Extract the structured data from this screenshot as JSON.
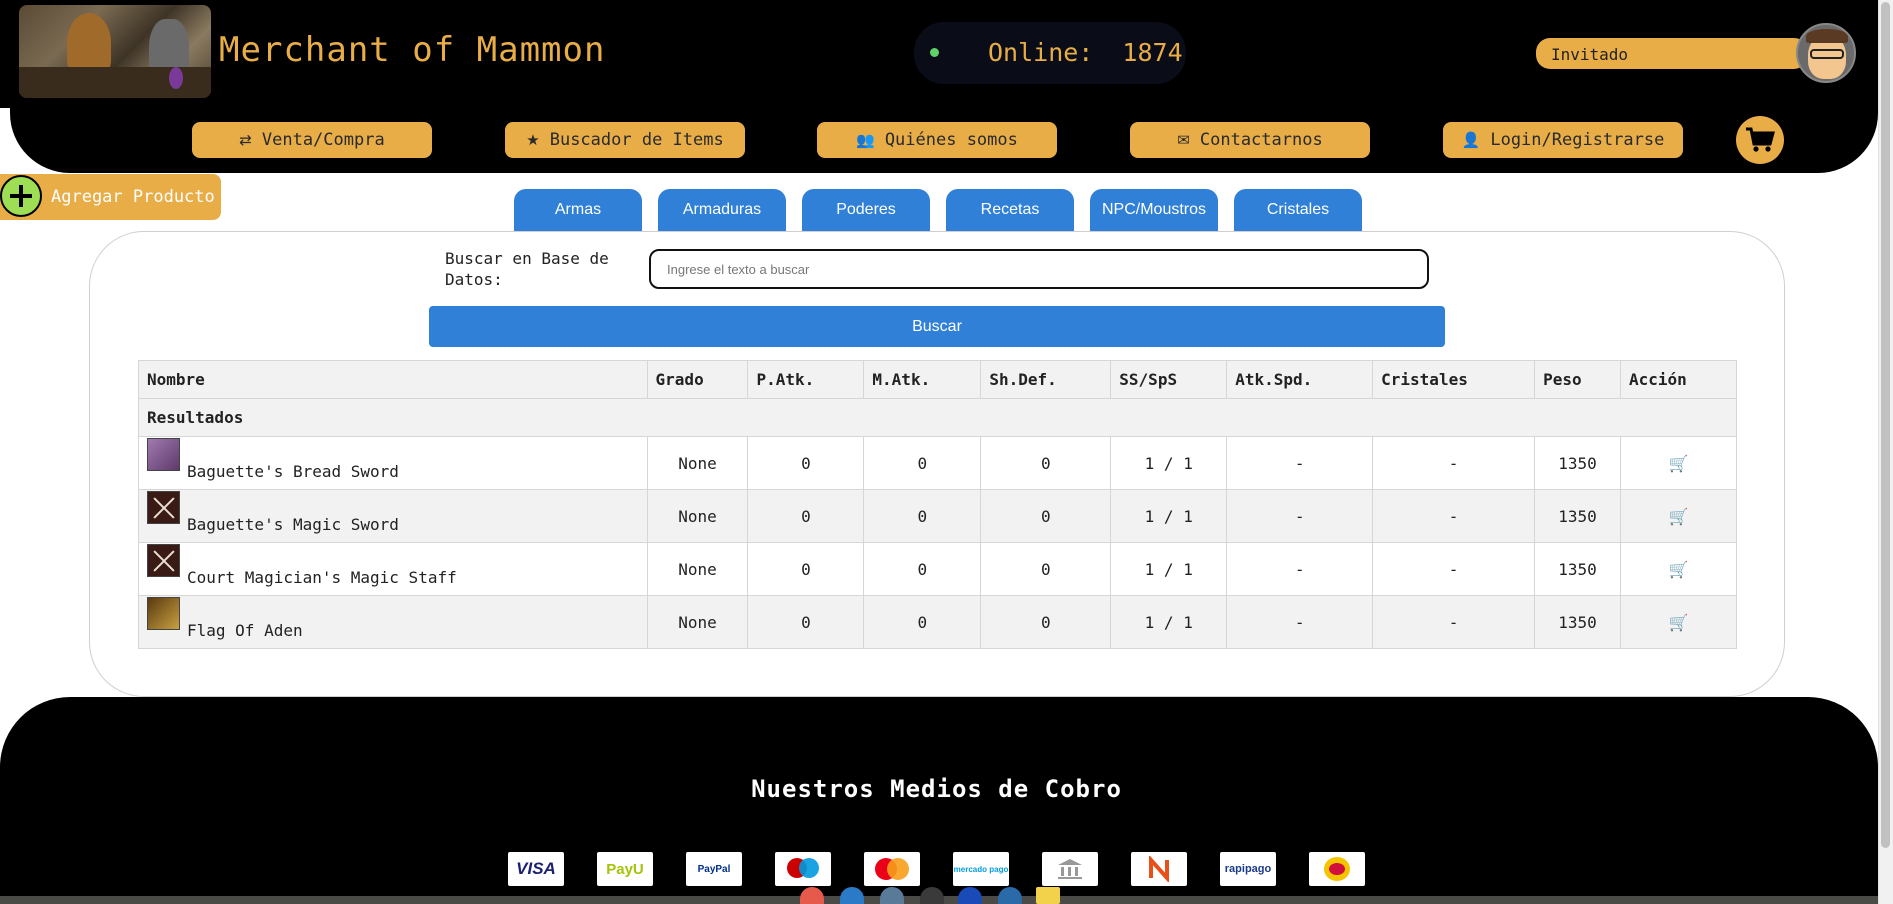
{
  "header": {
    "brand": "Merchant of Mammon",
    "online_label": "Online:",
    "online_count": "1874",
    "user_name": "Invitado"
  },
  "nav": [
    {
      "label": "Venta/Compra",
      "icon": "exchange-icon",
      "glyph": "⇄"
    },
    {
      "label": "Buscador de Items",
      "icon": "star-icon",
      "glyph": "★"
    },
    {
      "label": "Quiénes somos",
      "icon": "users-icon",
      "glyph": "👥"
    },
    {
      "label": "Contactarnos",
      "icon": "envelope-icon",
      "glyph": "✉"
    },
    {
      "label": "Login/Registrarse",
      "icon": "user-icon",
      "glyph": "👤"
    }
  ],
  "add_product_label": "Agregar Producto",
  "tabs": [
    "Armas",
    "Armaduras",
    "Poderes",
    "Recetas",
    "NPC/Moustros",
    "Cristales"
  ],
  "search": {
    "label": "Buscar en Base de Datos:",
    "placeholder": "Ingrese el texto a buscar",
    "button": "Buscar"
  },
  "table": {
    "columns": [
      "Nombre",
      "Grado",
      "P.Atk.",
      "M.Atk.",
      "Sh.Def.",
      "SS/SpS",
      "Atk.Spd.",
      "Cristales",
      "Peso",
      "Acción"
    ],
    "group_label": "Resultados",
    "rows": [
      {
        "name": "Baguette's Bread Sword",
        "icon": "bread-sword-icon",
        "grade": "None",
        "patk": "0",
        "matk": "0",
        "shdef": "0",
        "ss": "1 / 1",
        "atkspd": "-",
        "cristales": "-",
        "peso": "1350"
      },
      {
        "name": "Baguette's Magic Sword",
        "icon": "crossed-swords-icon",
        "grade": "None",
        "patk": "0",
        "matk": "0",
        "shdef": "0",
        "ss": "1 / 1",
        "atkspd": "-",
        "cristales": "-",
        "peso": "1350"
      },
      {
        "name": "Court Magician's Magic Staff",
        "icon": "crossed-swords-icon",
        "grade": "None",
        "patk": "0",
        "matk": "0",
        "shdef": "0",
        "ss": "1 / 1",
        "atkspd": "-",
        "cristales": "-",
        "peso": "1350"
      },
      {
        "name": "Flag Of Aden",
        "icon": "flag-icon",
        "grade": "None",
        "patk": "0",
        "matk": "0",
        "shdef": "0",
        "ss": "1 / 1",
        "atkspd": "-",
        "cristales": "-",
        "peso": "1350"
      }
    ]
  },
  "footer": {
    "title": "Nuestros Medios de Cobro",
    "payments": [
      {
        "name": "VISA",
        "color": "#1a1f71"
      },
      {
        "name": "PayU",
        "color": "#a6c307"
      },
      {
        "name": "PayPal",
        "color": "#003087"
      },
      {
        "name": "maestro",
        "color": "#cc0000"
      },
      {
        "name": "mastercard",
        "color": "#eb001b"
      },
      {
        "name": "mercado pago",
        "color": "#009ee3"
      },
      {
        "name": "banco",
        "color": "#888888"
      },
      {
        "name": "Naranja",
        "color": "#e8501a"
      },
      {
        "name": "rapipago",
        "color": "#1a3a8a"
      },
      {
        "name": "Pago Fácil",
        "color": "#f5c400"
      }
    ]
  },
  "colors": {
    "accent_gold": "#e8ad47",
    "primary_blue": "#2f80d6",
    "header_bg": "#000000",
    "online_green": "#5fd36a",
    "cart_blue": "#1a3fd6"
  }
}
